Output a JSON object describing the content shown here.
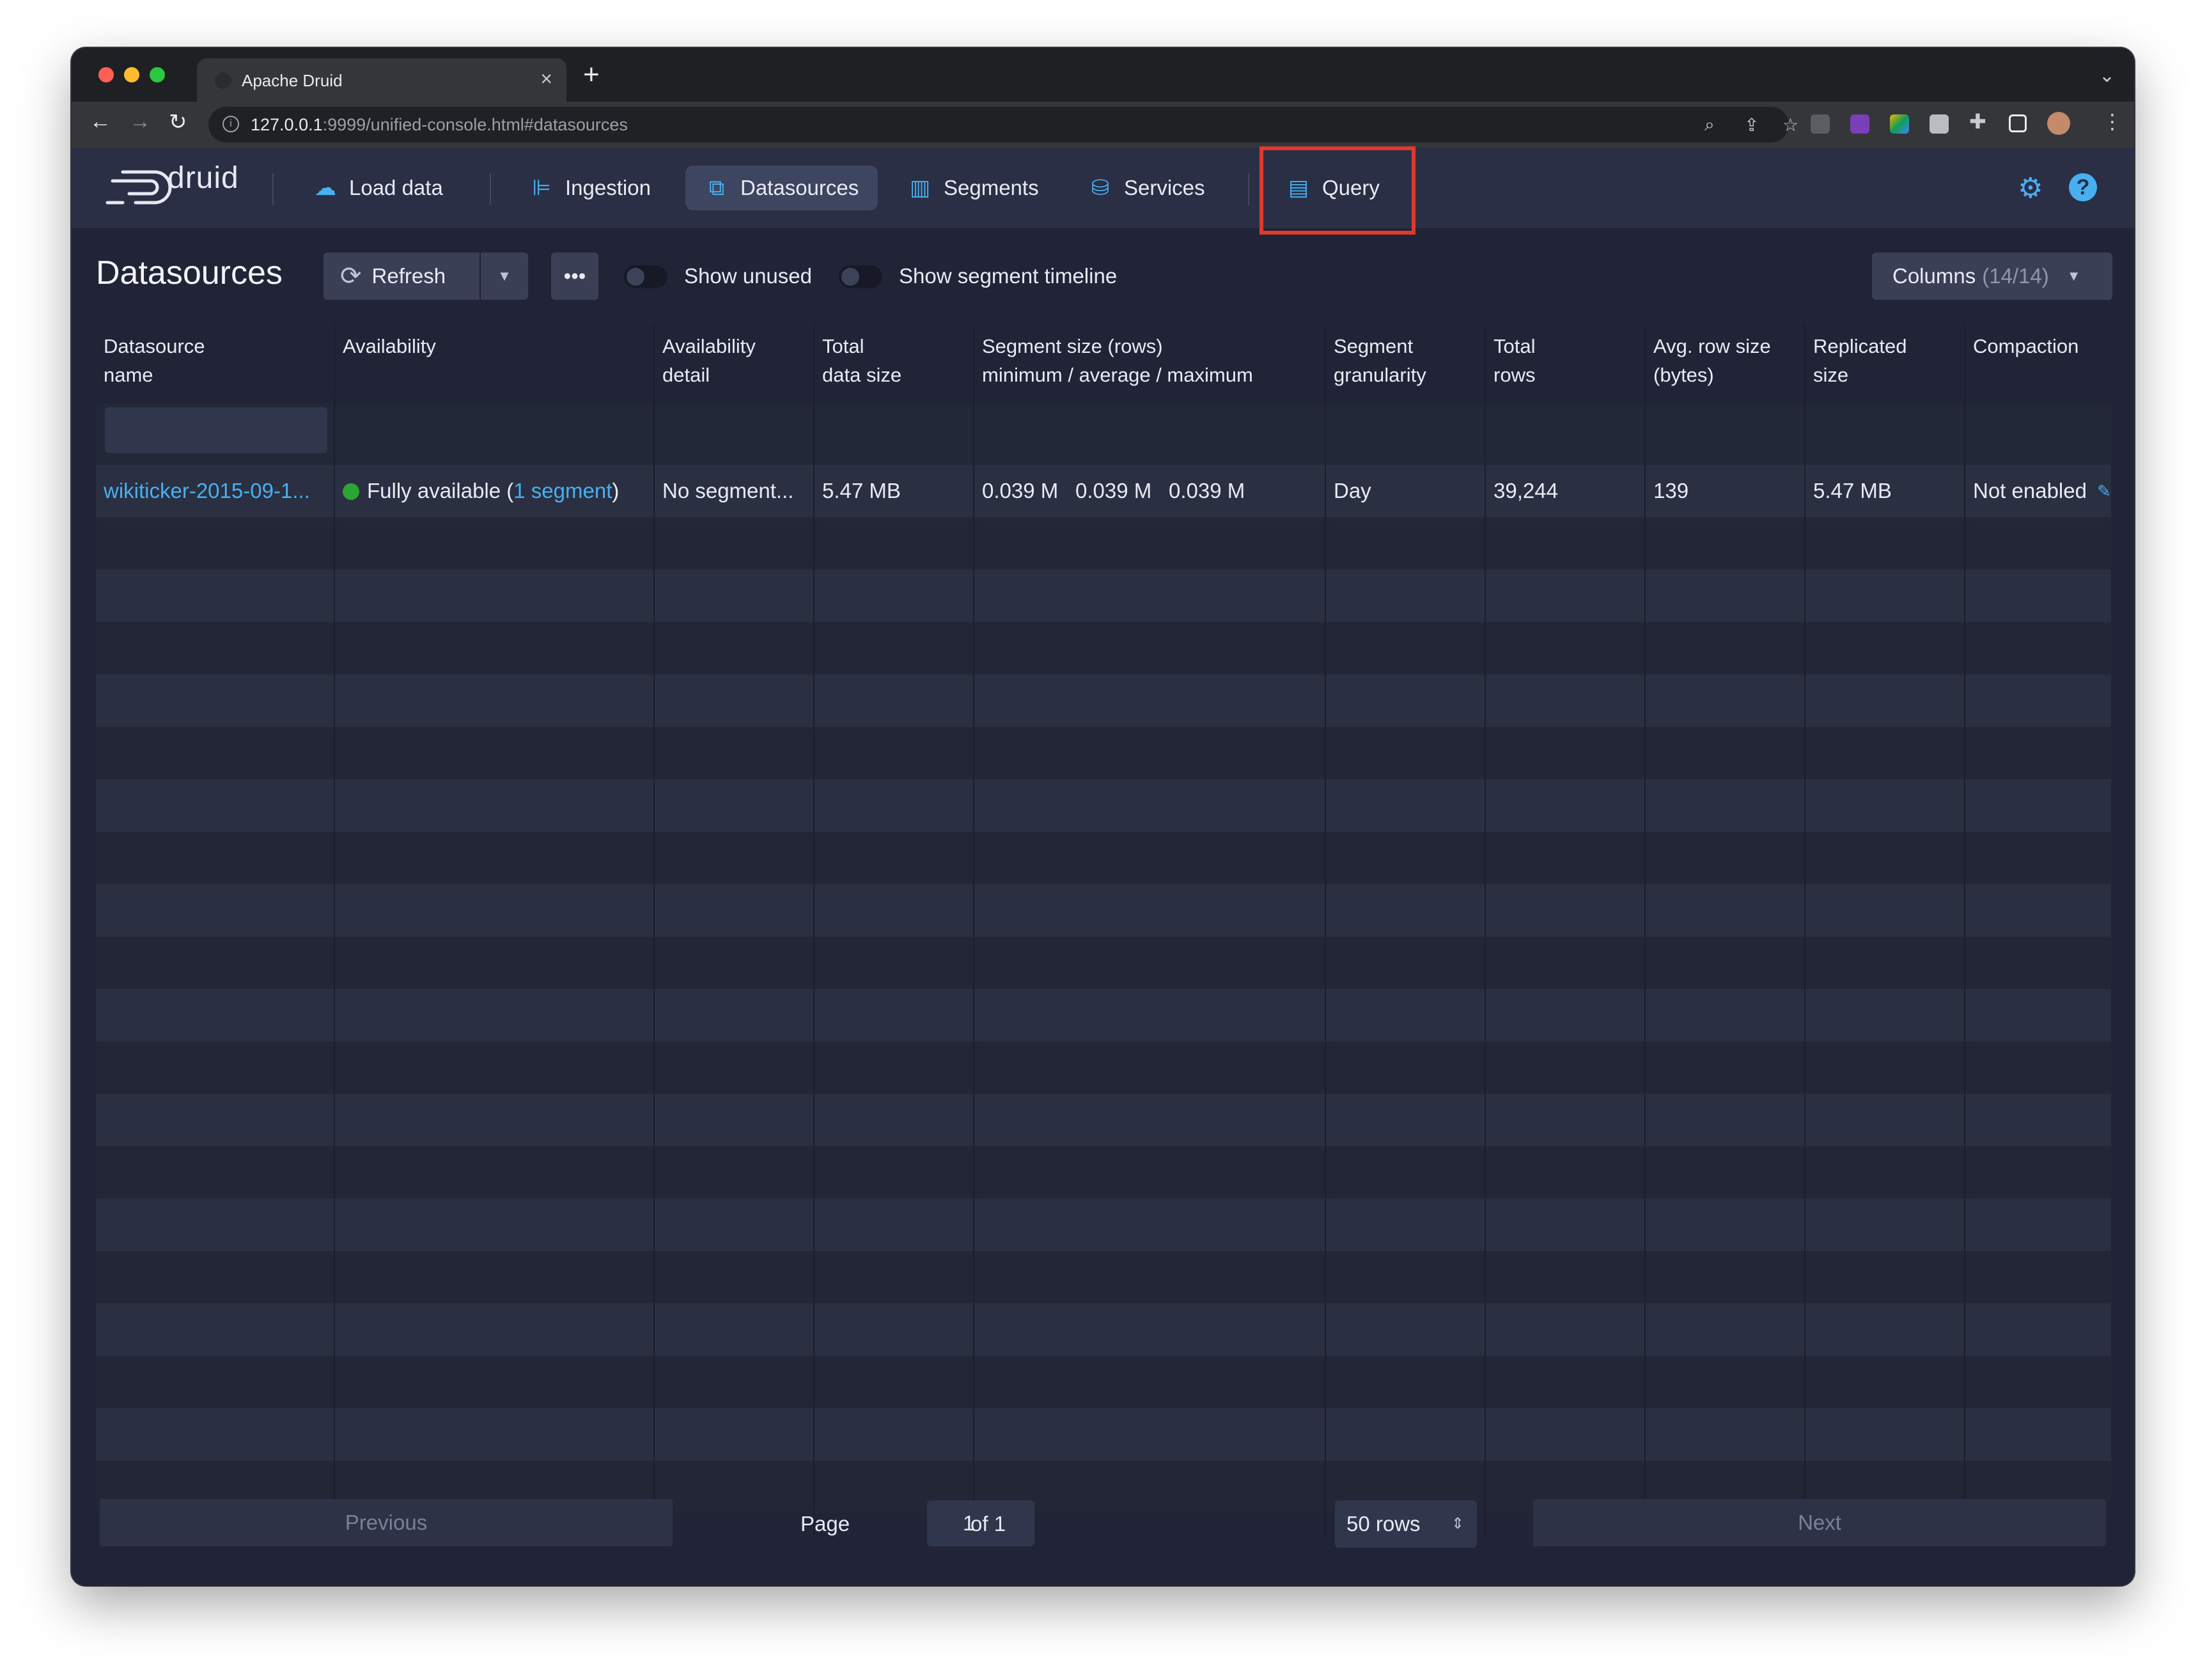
{
  "browser": {
    "tab_title": "Apache Druid",
    "url_host": "127.0.0.1",
    "url_rest": ":9999/unified-console.html#datasources"
  },
  "nav": {
    "logo_text": "druid",
    "items": [
      {
        "label": "Load data",
        "icon": "cloud-upload-icon"
      },
      {
        "label": "Ingestion",
        "icon": "gantt-chart-icon"
      },
      {
        "label": "Datasources",
        "icon": "multi-select-icon",
        "active": true
      },
      {
        "label": "Segments",
        "icon": "stacked-chart-icon"
      },
      {
        "label": "Services",
        "icon": "database-icon"
      },
      {
        "label": "Query",
        "icon": "application-icon",
        "highlighted": true
      }
    ],
    "highlight_color": "#e03a2c"
  },
  "toolbar": {
    "title": "Datasources",
    "refresh_label": "Refresh",
    "more_label": "•••",
    "show_unused_label": "Show unused",
    "show_timeline_label": "Show segment timeline",
    "columns_label": "Columns",
    "columns_count": "(14/14)"
  },
  "table": {
    "headers": [
      [
        "Datasource",
        "name"
      ],
      [
        "Availability",
        ""
      ],
      [
        "Availability",
        "detail"
      ],
      [
        "Total",
        "data size"
      ],
      [
        "Segment size (rows)",
        "minimum / average / maximum"
      ],
      [
        "Segment",
        "granularity"
      ],
      [
        "Total",
        "rows"
      ],
      [
        "Avg. row size",
        "(bytes)"
      ],
      [
        "Replicated",
        "size"
      ],
      [
        "Compaction",
        ""
      ]
    ],
    "rows": [
      {
        "name": "wikiticker-2015-09-1...",
        "availability_prefix": "Fully available (",
        "availability_link": "1 segment",
        "availability_suffix": ")",
        "availability_detail": "No segment...",
        "total_data_size": "5.47 MB",
        "seg_min": "0.039 M",
        "seg_avg": "0.039 M",
        "seg_max": "0.039 M",
        "granularity": "Day",
        "total_rows": "39,244",
        "avg_row_size": "139",
        "replicated_size": "5.47 MB",
        "compaction": "Not enabled"
      }
    ]
  },
  "pagination": {
    "previous": "Previous",
    "page_label": "Page",
    "page_value": "1",
    "of_label": "of 1",
    "rows_select": "50 rows",
    "next": "Next"
  }
}
